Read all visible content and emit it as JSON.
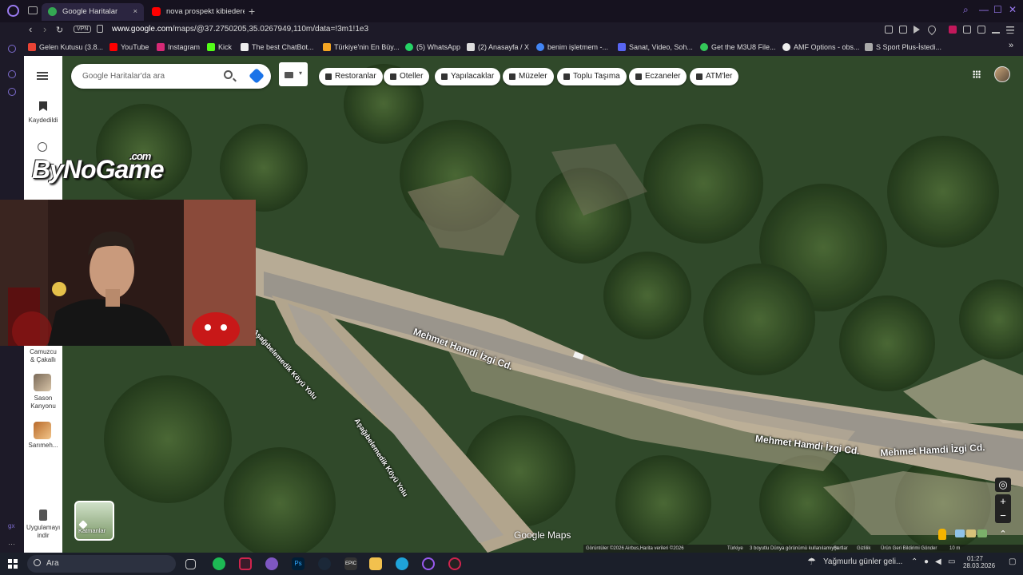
{
  "browser": {
    "tabs": [
      {
        "label": "Google Haritalar",
        "favicon_color": "#34a853"
      },
      {
        "label": "nova prospekt kibiedere -",
        "favicon_color": "#ff0000"
      }
    ],
    "url_host": "www.google.com",
    "url_path": "/maps/@37.2750205,35.0267949,110m/data=!3m1!1e3",
    "vpn_label": "VPN",
    "bookmarks": [
      {
        "label": "Gelen Kutusu (3.8...",
        "color": "#ea4335"
      },
      {
        "label": "YouTube",
        "color": "#ff0000"
      },
      {
        "label": "Instagram",
        "color": "#d62976"
      },
      {
        "label": "Kick",
        "color": "#53fc18"
      },
      {
        "label": "The best ChatBot...",
        "color": "#eeeeee"
      },
      {
        "label": "Türkiye'nin En Büy...",
        "color": "#f5a623"
      },
      {
        "label": "(5) WhatsApp",
        "color": "#25d366"
      },
      {
        "label": "(2) Anasayfa / X",
        "color": "#dddddd"
      },
      {
        "label": "benim işletmem -...",
        "color": "#4285f4"
      },
      {
        "label": "Sanat, Video, Soh...",
        "color": "#5865f2"
      },
      {
        "label": "Get the M3U8 File...",
        "color": "#34c759"
      },
      {
        "label": "AMF Options - obs...",
        "color": "#eeeeee"
      },
      {
        "label": "S Sport Plus-İstedi...",
        "color": "#aaaaaa"
      }
    ]
  },
  "maps": {
    "search_placeholder": "Google Haritalar'da ara",
    "chips": [
      "Restoranlar",
      "Oteller",
      "Yapılacaklar",
      "Müzeler",
      "Toplu Taşıma",
      "Eczaneler",
      "ATM'ler"
    ],
    "sidebar": {
      "menu_icon": "hamburger-icon",
      "saved_label": "Kaydedildi",
      "recent_places": [
        "Camuzcu & Çakallı",
        "Sason Kanyonu",
        "Sarımeh..."
      ],
      "apps_label": "Uygulamayı indir"
    },
    "road_labels": [
      "Mehmet Hamdi İzgi Cd.",
      "Mehmet Hamdi İzgi Cd.",
      "Mehmet Hamdi İzgi Cd.",
      "Aşağıbelemedik Köyü Yolu",
      "Aşağıbelemedik Köyü Yolu"
    ],
    "layers_label": "Katmanlar",
    "google_maps_text": "Google Maps",
    "footer": [
      "Görüntüler ©2026 Airbus,Harita verileri ©2026",
      "Türkiye",
      "3 boyutlu Dünya görünümü kullanılamıyor",
      "Şartlar",
      "Gizlilik",
      "Ürün Geri Bildirimi Gönder",
      "10 m"
    ]
  },
  "overlay": {
    "logo_text": "ByNoGame",
    "logo_suffix": ".com"
  },
  "taskbar": {
    "search_label": "Ara",
    "weather": "Yağmurlu günler geli...",
    "time": "01:27",
    "date": "28.03.2026"
  }
}
